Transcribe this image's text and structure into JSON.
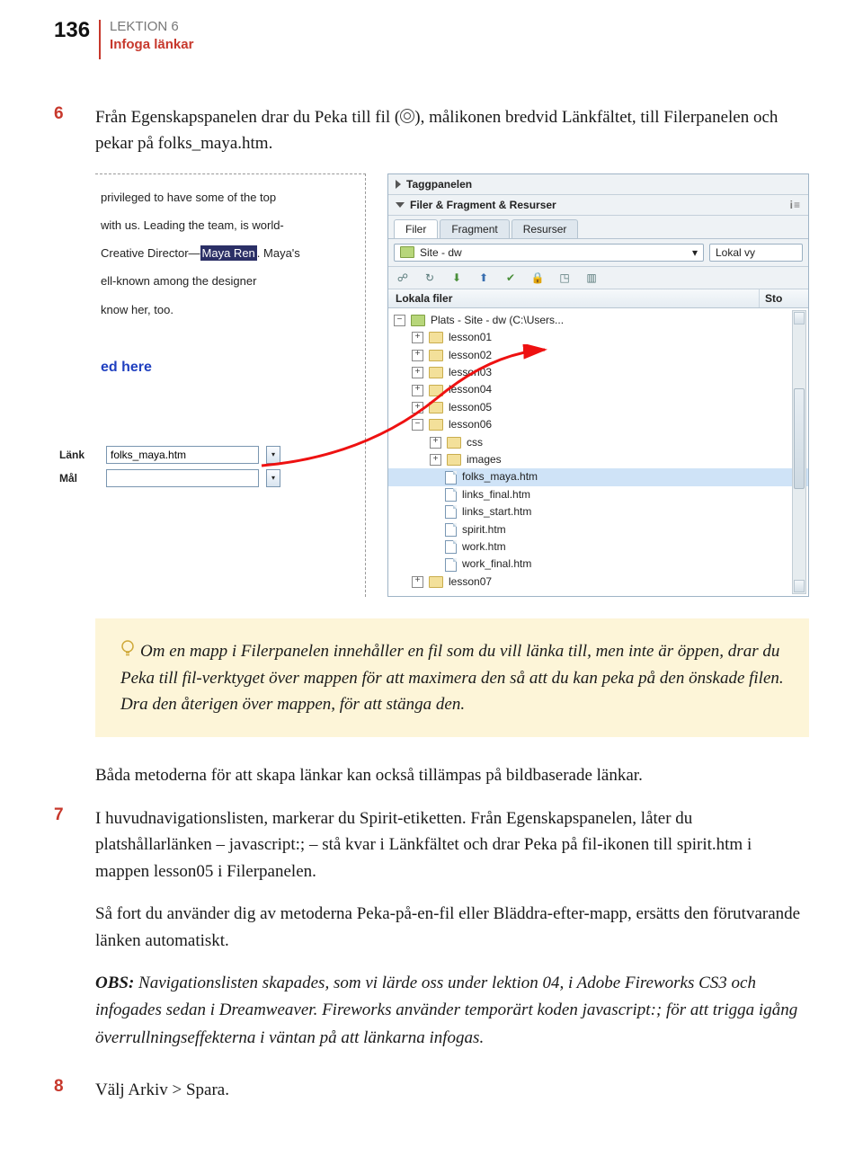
{
  "header": {
    "page_number": "136",
    "lesson_label": "LEKTION 6",
    "lesson_title": "Infoga länkar"
  },
  "step6": {
    "num": "6",
    "text_before_icon": "Från Egenskapspanelen drar du Peka till fil (",
    "text_after_icon": "), målikonen bredvid Länkfältet, till Filerpanelen och pekar på folks_maya.htm."
  },
  "editor": {
    "l1": "privileged to have some of the top",
    "l2": "with us. Leading the team, is world-",
    "l3_a": "Creative Director—",
    "l3_sel": "Maya Ren",
    "l3_b": ". Maya's",
    "l4": "ell-known among the designer",
    "l5": "know her, too.",
    "ed_here": "ed here"
  },
  "link_props": {
    "link_label": "Länk",
    "link_value": "folks_maya.htm",
    "mal_label": "Mål"
  },
  "panel": {
    "tagg_label": "Taggpanelen",
    "filer_res_label": "Filer & Fragment & Resurser",
    "tabs": {
      "filer": "Filer",
      "fragment": "Fragment",
      "resurser": "Resurser"
    },
    "site_dd": "Site - dw",
    "view_dd": "Lokal vy",
    "list_col1": "Lokala filer",
    "list_col2": "Sto",
    "tree": {
      "root": "Plats - Site - dw (C:\\Users...",
      "lesson01": "lesson01",
      "lesson02": "lesson02",
      "lesson03": "lesson03",
      "lesson04": "lesson04",
      "lesson05": "lesson05",
      "lesson06": "lesson06",
      "css": "css",
      "images": "images",
      "folks": "folks_maya.htm",
      "links_final": "links_final.htm",
      "links_start": "links_start.htm",
      "spirit": "spirit.htm",
      "work": "work.htm",
      "work_final": "work_final.htm",
      "lesson07": "lesson07"
    }
  },
  "tip": "Om en mapp i Filerpanelen innehåller en fil som du vill länka till, men inte är öppen, drar du Peka till fil-verktyget över mappen för att maximera den så att du kan peka på den önskade filen. Dra den återigen över mappen, för att stänga den.",
  "para_both": "Båda metoderna för att skapa länkar kan också tillämpas på bildbaserade länkar.",
  "step7": {
    "num": "7",
    "sentence1": "I huvudnavigationslisten, markerar du Spirit-etiketten.",
    "rest": " Från Egenskapspanelen, låter du platshållarlänken – javascript:; – stå kvar i Länkfältet och drar Peka på fil-ikonen till spirit.htm i mappen lesson05 i Filerpanelen.",
    "para2": "Så fort du använder dig av metoderna Peka-på-en-fil eller Bläddra-efter-mapp, ersätts den förutvarande länken automatiskt."
  },
  "obs": {
    "label": "OBS:",
    "text": " Navigationslisten skapades, som vi lärde oss under lektion 04, i Adobe Fireworks CS3 och infogades sedan i Dreamweaver. Fireworks använder temporärt koden javascript:; för att trigga igång överrullningseffekterna i väntan på att länkarna infogas."
  },
  "step8": {
    "num": "8",
    "text": "Välj Arkiv > Spara."
  }
}
